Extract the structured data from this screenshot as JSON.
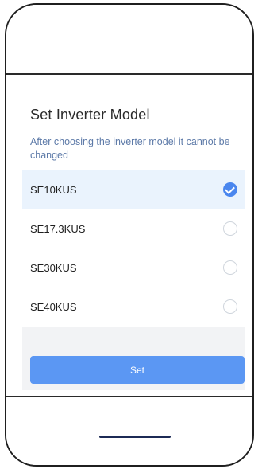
{
  "dialog": {
    "title": "Set Inverter Model",
    "subtitle": "After choosing the inverter model it cannot be changed"
  },
  "models": [
    {
      "label": "SE10KUS",
      "selected": true
    },
    {
      "label": "SE17.3KUS",
      "selected": false
    },
    {
      "label": "SE30KUS",
      "selected": false
    },
    {
      "label": "SE40KUS",
      "selected": false
    }
  ],
  "buttons": {
    "set_label": "Set"
  },
  "colors": {
    "accent": "#5b97f3",
    "selected_bg": "#eaf3fd",
    "subtitle_text": "#5d7aa8",
    "check_fill": "#4a86ee"
  }
}
